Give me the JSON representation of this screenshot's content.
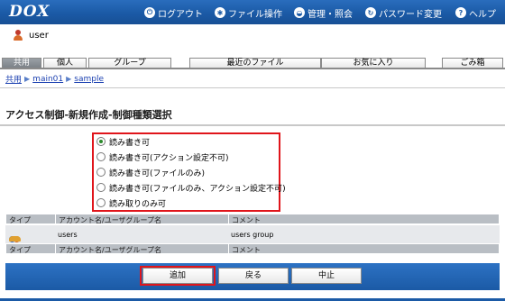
{
  "header": {
    "logo": "DOX",
    "nav": [
      {
        "label": "ログアウト",
        "icon": "logout-icon"
      },
      {
        "label": "ファイル操作",
        "icon": "file-operation-icon"
      },
      {
        "label": "管理・照会",
        "icon": "admin-icon"
      },
      {
        "label": "パスワード変更",
        "icon": "password-change-icon"
      },
      {
        "label": "ヘルプ",
        "icon": "help-icon"
      }
    ]
  },
  "user": {
    "name": "user"
  },
  "tabs": [
    "共用",
    "個人",
    "グループ",
    "最近のファイル",
    "お気に入り",
    "ごみ箱"
  ],
  "breadcrumb": [
    "共用",
    "main01",
    "sample"
  ],
  "page_title": "アクセス制御-新規作成-制御種類選択",
  "options": [
    {
      "label": "読み書き可",
      "selected": true
    },
    {
      "label": "読み書き可(アクション設定不可)",
      "selected": false
    },
    {
      "label": "読み書き可(ファイルのみ)",
      "selected": false
    },
    {
      "label": "読み書き可(ファイルのみ、アクション設定不可)",
      "selected": false
    },
    {
      "label": "読み取りのみ可",
      "selected": false
    }
  ],
  "table": {
    "headers": [
      "タイプ",
      "アカウント名/ユーザグループ名",
      "コメント"
    ],
    "rows": [
      {
        "type_icon": "user-group-icon",
        "account": "users",
        "comment": "users group"
      }
    ]
  },
  "buttons": {
    "add": "追加",
    "back": "戻る",
    "cancel": "中止"
  },
  "colors": {
    "brand": "#1b5aa6",
    "highlight": "#e0151b",
    "table_header": "#b9bec4"
  }
}
